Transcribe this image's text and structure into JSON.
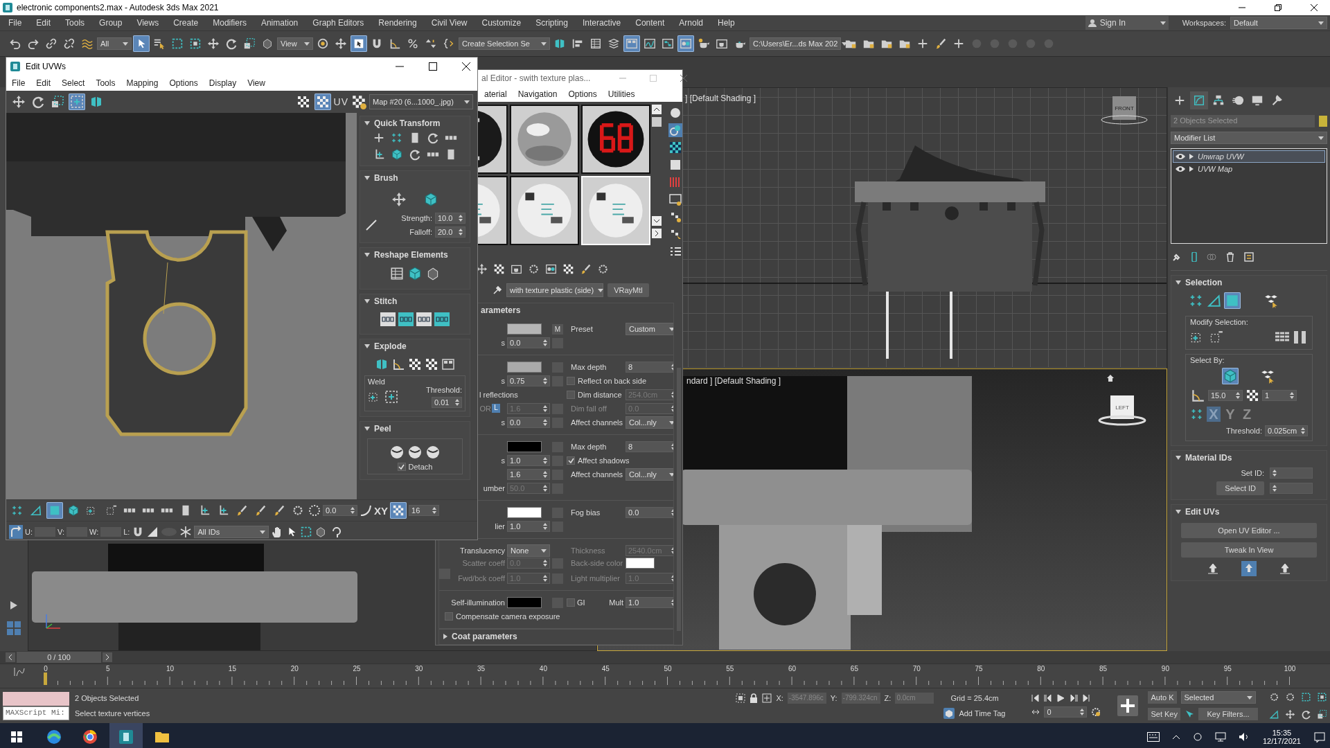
{
  "window": {
    "title": "electronic components2.max - Autodesk 3ds Max 2021"
  },
  "menu": [
    "File",
    "Edit",
    "Tools",
    "Group",
    "Views",
    "Create",
    "Modifiers",
    "Animation",
    "Graph Editors",
    "Rendering",
    "Civil View",
    "Customize",
    "Scripting",
    "Interactive",
    "Content",
    "Arnold",
    "Help"
  ],
  "sign_in": "Sign In",
  "workspaces": {
    "label": "Workspaces:",
    "value": "Default"
  },
  "toolbar": [
    {
      "kind": "undo",
      "selected": false
    },
    {
      "kind": "redo",
      "selected": false
    },
    {
      "kind": "link",
      "selected": false
    },
    {
      "kind": "unlink",
      "selected": false
    },
    {
      "kind": "bind",
      "selected": false
    },
    {
      "kind": "dropdown",
      "value": "All"
    },
    {
      "kind": "select",
      "selected": true
    },
    {
      "kind": "select-list",
      "selected": false
    },
    {
      "kind": "region",
      "selected": false
    },
    {
      "kind": "crossing",
      "selected": false
    },
    {
      "kind": "move",
      "selected": false
    },
    {
      "kind": "rotate",
      "selected": false
    },
    {
      "kind": "scale",
      "selected": false
    },
    {
      "kind": "place",
      "selected": false
    },
    {
      "kind": "dropdown",
      "value": "View"
    },
    {
      "kind": "pivot",
      "selected": false
    },
    {
      "kind": "move",
      "selected": false
    },
    {
      "kind": "manipulate",
      "selected": true
    },
    {
      "kind": "snap",
      "selected": false
    },
    {
      "kind": "angle-snap",
      "selected": false
    },
    {
      "kind": "percent-snap",
      "selected": false
    },
    {
      "kind": "spinner-snap",
      "selected": false
    },
    {
      "kind": "named-set",
      "selected": false
    },
    {
      "kind": "dropdown",
      "value": "Create Selection Se"
    },
    {
      "kind": "mirror",
      "selected": false
    },
    {
      "kind": "align",
      "selected": false
    },
    {
      "kind": "explorer",
      "selected": false
    },
    {
      "kind": "layer",
      "selected": false
    },
    {
      "kind": "ribbon",
      "selected": true
    },
    {
      "kind": "curve-editor",
      "selected": false
    },
    {
      "kind": "schematic",
      "selected": false
    },
    {
      "kind": "material",
      "selected": true
    },
    {
      "kind": "render-setup",
      "selected": false
    },
    {
      "kind": "render-frame",
      "selected": false
    },
    {
      "kind": "render",
      "selected": false
    },
    {
      "kind": "dropdown",
      "value": "C:\\Users\\Er...ds Max 202"
    },
    {
      "kind": "folder",
      "selected": false
    },
    {
      "kind": "folder",
      "selected": false
    },
    {
      "kind": "folder",
      "selected": false
    },
    {
      "kind": "folder",
      "selected": false
    },
    {
      "kind": "plus",
      "selected": false
    },
    {
      "kind": "brush",
      "selected": false
    },
    {
      "kind": "plus",
      "selected": false
    },
    {
      "kind": "dim",
      "selected": false
    },
    {
      "kind": "dim",
      "selected": false
    },
    {
      "kind": "dim",
      "selected": false
    },
    {
      "kind": "dim",
      "selected": false
    },
    {
      "kind": "dim",
      "selected": false
    }
  ],
  "viewports": [
    {
      "label": "] [Default Shading ]",
      "viewcube": "FRONT",
      "active": false
    },
    {
      "label": "ndard ] [Default Shading ]",
      "viewcube": "LEFT",
      "active": true
    }
  ],
  "command_panel": {
    "tabs": [
      {
        "kind": "create",
        "selected": false
      },
      {
        "kind": "modify",
        "selected": true
      },
      {
        "kind": "hierarchy",
        "selected": false
      },
      {
        "kind": "motion",
        "selected": false
      },
      {
        "kind": "display",
        "selected": false
      },
      {
        "kind": "utilities",
        "selected": false
      }
    ],
    "object": {
      "name": "2 Objects Selected",
      "color": "#c9b43a"
    },
    "modifier_list": "Modifier List",
    "modifiers": [
      {
        "name": "Unwrap UVW",
        "selected": true
      },
      {
        "name": "UVW Map",
        "selected": false
      }
    ],
    "selection": {
      "title": "Selection",
      "modes": [
        {
          "kind": "vertex",
          "selected": false
        },
        {
          "kind": "edge",
          "selected": false
        },
        {
          "kind": "poly",
          "selected": true
        },
        {
          "kind": "element-select",
          "selected": false
        }
      ],
      "modify_label": "Modify Selection:",
      "select_by_label": "Select By:",
      "select_by": [
        {
          "kind": "cube",
          "selected": true
        },
        {
          "kind": "element-select",
          "selected": false
        }
      ],
      "angle": "15.0",
      "count": "1",
      "axes": [
        {
          "label": "X",
          "selected": true
        },
        {
          "label": "Y",
          "selected": false
        },
        {
          "label": "Z",
          "selected": false
        }
      ],
      "threshold_label": "Threshold:",
      "threshold": "0.025cm"
    },
    "material_ids": {
      "title": "Material IDs",
      "set_id_label": "Set ID:",
      "select_id": "Select ID"
    },
    "edit_uvs": {
      "title": "Edit UVs",
      "buttons": [
        "Open UV Editor ...",
        "Tweak In View"
      ]
    }
  },
  "timeline": {
    "frame": "0 / 100",
    "ticks": [
      "0",
      "5",
      "10",
      "15",
      "20",
      "25",
      "30",
      "35",
      "40",
      "45",
      "50",
      "55",
      "60",
      "65",
      "70",
      "75",
      "80",
      "85",
      "90",
      "95",
      "100"
    ]
  },
  "status": {
    "maxscript": "MAXScript Mi:",
    "selected": "2 Objects Selected",
    "prompt": "Select texture vertices",
    "x_label": "X:",
    "x": "-3547.896c",
    "y_label": "Y:",
    "y": "-799.324cn",
    "z_label": "Z:",
    "z": "0.0cm",
    "grid": "Grid = 25.4cm",
    "add_time_tag": "Add Time Tag",
    "auto_key": "Auto K",
    "set_key": "Set Key",
    "key_mode": "Selected",
    "key_filters": "Key Filters...",
    "current_frame": "0"
  },
  "taskbar": {
    "time": "15:35",
    "date": "12/17/2021"
  },
  "uv_editor": {
    "title": "Edit UVWs",
    "menu": [
      "File",
      "Edit",
      "Select",
      "Tools",
      "Mapping",
      "Options",
      "Display",
      "View"
    ],
    "tools": [
      {
        "kind": "move",
        "selected": false
      },
      {
        "kind": "rotate",
        "selected": false
      },
      {
        "kind": "scale",
        "selected": false
      },
      {
        "kind": "freeform",
        "selected": true
      },
      {
        "kind": "mirror",
        "selected": false
      }
    ],
    "view_tools": [
      {
        "kind": "checker",
        "selected": false
      },
      {
        "kind": "checker",
        "selected": true
      }
    ],
    "uv_label": "UV",
    "map": "Map #20 (6...1000_.jpg)",
    "rollouts": [
      {
        "kind": "quick_transform",
        "title": "Quick Transform"
      },
      {
        "kind": "brush",
        "title": "Brush",
        "strength_label": "Strength:",
        "strength": "10.0",
        "falloff_label": "Falloff:",
        "falloff": "20.0"
      },
      {
        "kind": "reshape",
        "title": "Reshape Elements"
      },
      {
        "kind": "stitch",
        "title": "Stitch"
      },
      {
        "kind": "explode",
        "title": "Explode",
        "weld_label": "Weld",
        "threshold_label": "Threshold:",
        "threshold": "0.01"
      },
      {
        "kind": "peel",
        "title": "Peel",
        "detach_label": "Detach",
        "detach_checked": true
      }
    ],
    "sub_tools": [
      {
        "kind": "vertex",
        "selected": false
      },
      {
        "kind": "edge",
        "selected": false
      },
      {
        "kind": "poly",
        "selected": true
      },
      {
        "kind": "cube",
        "selected": false
      },
      {
        "kind": "grow",
        "selected": false
      },
      {
        "kind": "shrink",
        "selected": false
      },
      {
        "kind": "loop",
        "selected": false
      },
      {
        "kind": "loop",
        "selected": false
      },
      {
        "kind": "loop",
        "selected": false
      },
      {
        "kind": "bar",
        "selected": false
      },
      {
        "kind": "pin",
        "selected": false
      },
      {
        "kind": "pin",
        "selected": false
      },
      {
        "kind": "brush",
        "selected": false
      },
      {
        "kind": "brush",
        "selected": false
      },
      {
        "kind": "brush",
        "selected": false
      },
      {
        "kind": "gear",
        "selected": false
      }
    ],
    "rotation": "0.0",
    "axis": "XY",
    "grid_snap_selected": true,
    "grid": "16",
    "u_label": "U:",
    "v_label": "V:",
    "w_label": "W:",
    "l_label": "L:",
    "ids": "All IDs"
  },
  "material_editor": {
    "title": "al Editor - swith texture plas...",
    "menu": [
      "aterial",
      "Navigation",
      "Options",
      "Utilities"
    ],
    "slots": [
      {
        "kind": "segment",
        "selected": false
      },
      {
        "kind": "chrome",
        "selected": false
      },
      {
        "kind": "display",
        "selected": false
      },
      {
        "kind": "printed",
        "selected": false
      },
      {
        "kind": "printed",
        "selected": false
      },
      {
        "kind": "printed",
        "selected": true
      }
    ],
    "material_name": "with texture plastic (side)",
    "material_type": "VRayMtl",
    "section": "arameters",
    "groups": [
      [
        {
          "control": {
            "kind": "swatch",
            "color": "#b5b5b5",
            "map": "M"
          },
          "right": {
            "kind": "dropdown",
            "label": "Preset",
            "value": "Custom"
          }
        },
        {
          "label": "s",
          "control": {
            "kind": "spinner",
            "value": "0.0",
            "disabled": false
          }
        }
      ],
      [
        {
          "control": {
            "kind": "swatch",
            "color": "#a9a9a9"
          },
          "right": {
            "kind": "spinner",
            "label": "Max depth",
            "value": "8",
            "disabled": false
          }
        },
        {
          "label": "s",
          "control": {
            "kind": "spinner",
            "value": "0.75",
            "disabled": false
          },
          "right": {
            "kind": "checkbox",
            "label": "Reflect on back side",
            "checked": false
          }
        },
        {
          "label": "l reflections",
          "control": {
            "kind": "none"
          },
          "right": {
            "kind": "checkbox_spinner",
            "label": "Dim distance",
            "checked": false,
            "value": "254.0cm",
            "disabled": true
          }
        },
        {
          "label": "OR",
          "disabled": true,
          "control": {
            "kind": "spinner",
            "value": "1.6",
            "disabled": true,
            "lock": "L"
          },
          "right": {
            "kind": "spinner",
            "label": "Dim fall off",
            "value": "0.0",
            "disabled": true
          }
        },
        {
          "label": "s",
          "control": {
            "kind": "spinner",
            "value": "0.0",
            "disabled": false
          },
          "right": {
            "kind": "dropdown",
            "label": "Affect channels",
            "value": "Col...nly"
          }
        }
      ],
      [
        {
          "control": {
            "kind": "swatch",
            "color": "#000000"
          },
          "right": {
            "kind": "spinner",
            "label": "Max depth",
            "value": "8",
            "disabled": false
          }
        },
        {
          "label": "s",
          "control": {
            "kind": "spinner",
            "value": "1.0",
            "disabled": false
          },
          "right": {
            "kind": "checkbox",
            "label": "Affect shadows",
            "checked": true
          }
        },
        {
          "control": {
            "kind": "spinner",
            "value": "1.6",
            "disabled": false
          },
          "right": {
            "kind": "dropdown",
            "label": "Affect channels",
            "value": "Col...nly"
          }
        },
        {
          "label": "umber",
          "control": {
            "kind": "spinner",
            "value": "50.0",
            "disabled": true
          }
        }
      ],
      [
        {
          "control": {
            "kind": "swatch",
            "color": "#ffffff"
          },
          "right": {
            "kind": "spinner",
            "label": "Fog bias",
            "value": "0.0",
            "disabled": false
          }
        },
        {
          "label": "lier",
          "control": {
            "kind": "spinner",
            "value": "1.0",
            "disabled": false
          }
        }
      ],
      [
        {
          "label": "Translucency",
          "control": {
            "kind": "dropdown",
            "value": "None"
          },
          "right": {
            "kind": "spinner",
            "label": "Thickness",
            "value": "2540.0cm",
            "disabled": true
          }
        },
        {
          "label": "Scatter coeff",
          "disabled": true,
          "control": {
            "kind": "spinner",
            "value": "0.0",
            "disabled": true
          },
          "right": {
            "kind": "swatch",
            "label": "Back-side color",
            "color": "#ffffff",
            "disabled": true
          }
        },
        {
          "label": "Fwd/bck coeff",
          "disabled": true,
          "control": {
            "kind": "spinner",
            "value": "1.0",
            "disabled": true
          },
          "right": {
            "kind": "spinner",
            "label": "Light multiplier",
            "value": "1.0",
            "disabled": true
          }
        }
      ],
      [
        {
          "label": "Self-illumination",
          "control": {
            "kind": "swatch",
            "color": "#000000",
            "checkbox": {
              "label": "GI",
              "checked": false
            }
          },
          "right": {
            "kind": "spinner",
            "label": "Mult",
            "value": "1.0",
            "disabled": false
          }
        },
        {
          "control": {
            "kind": "checkbox",
            "label": "Compensate camera exposure",
            "checked": false
          }
        }
      ]
    ],
    "coat": "Coat parameters"
  }
}
